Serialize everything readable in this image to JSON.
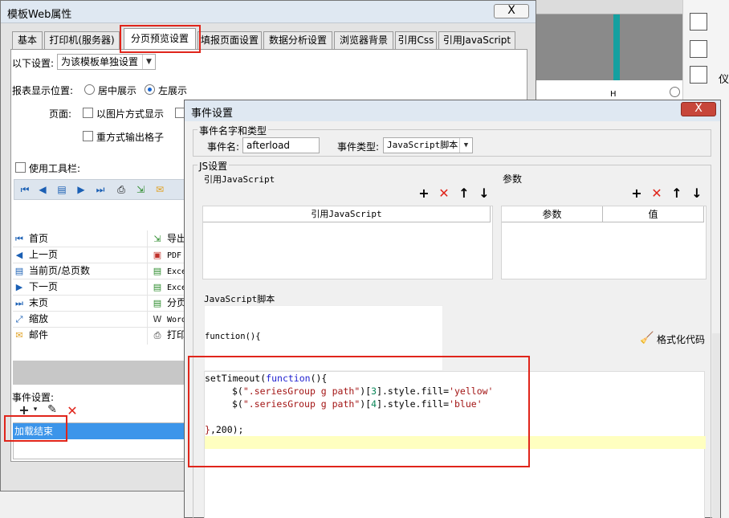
{
  "dialog_main": {
    "title": "模板Web属性",
    "close": "X",
    "tabs": [
      "基本",
      "打印机(服务器)",
      "分页预览设置",
      "填报页面设置",
      "数据分析设置",
      "浏览器背景",
      "引用Css",
      "引用JavaScript"
    ],
    "settings_label": "以下设置:",
    "settings_value": "为该模板单独设置",
    "display_position_label": "报表显示位置:",
    "center_display": "居中展示",
    "left_display": "左展示",
    "page_label": "页面:",
    "image_mode": "以图片方式显示",
    "output_grid": "重方式输出格子",
    "use_toolbar": "使用工具栏:",
    "toolbar_items": [
      {
        "label": "首页",
        "icon": "first-page-icon"
      },
      {
        "label": "上一页",
        "icon": "prev-page-icon"
      },
      {
        "label": "当前页/总页数",
        "icon": "page-count-icon"
      },
      {
        "label": "下一页",
        "icon": "next-page-icon"
      },
      {
        "label": "末页",
        "icon": "last-page-icon"
      },
      {
        "label": "缩放",
        "icon": "zoom-icon"
      },
      {
        "label": "邮件",
        "icon": "mail-icon"
      }
    ],
    "export_items": [
      {
        "label": "导出",
        "icon": "export-icon"
      },
      {
        "label": "PDF",
        "icon": "pdf-icon"
      },
      {
        "label": "Exce",
        "icon": "excel-icon"
      },
      {
        "label": "Exce",
        "icon": "excel-icon"
      },
      {
        "label": "分页",
        "icon": "excel-icon"
      },
      {
        "label": "Word",
        "icon": "word-icon"
      },
      {
        "label": "打印",
        "icon": "print-icon"
      }
    ],
    "event_label": "事件设置:",
    "event_selected": "加载结束"
  },
  "dialog_event": {
    "title": "事件设置",
    "close": "X",
    "name_type_group": "事件名字和类型",
    "event_name_label": "事件名:",
    "event_name_value": "afterload",
    "event_type_label": "事件类型:",
    "event_type_value": "JavaScript脚本",
    "js_group": "JS设置",
    "ref_js_label": "引用JavaScript",
    "ref_js_column": "引用JavaScript",
    "params_label": "参数",
    "params_col_name": "参数",
    "params_col_value": "值",
    "script_label": "JavaScript脚本",
    "function_header": "function(){",
    "format_code": "格式化代码"
  },
  "code": {
    "l1_a": "setTimeout(",
    "l1_b": "function",
    "l1_c": "(){",
    "l2_a": "$(",
    "l2_b": "\".seriesGroup g path\"",
    "l2_c": ")[",
    "l2_d": "3",
    "l2_e": "].style.fill=",
    "l2_f": "'yellow'",
    "l3_a": "$(",
    "l3_b": "\".seriesGroup g path\"",
    "l3_c": ")[",
    "l3_d": "4",
    "l3_e": "].style.fill=",
    "l3_f": "'blue'",
    "l5_a": "}",
    "l5_b": ",200);"
  },
  "background": {
    "col_letter": "H",
    "side_label": "仪"
  },
  "colors": {
    "highlight_box": "#e0251b",
    "selection": "#3c95ea",
    "keyword": "#1d1dcf",
    "string": "#a31515"
  }
}
